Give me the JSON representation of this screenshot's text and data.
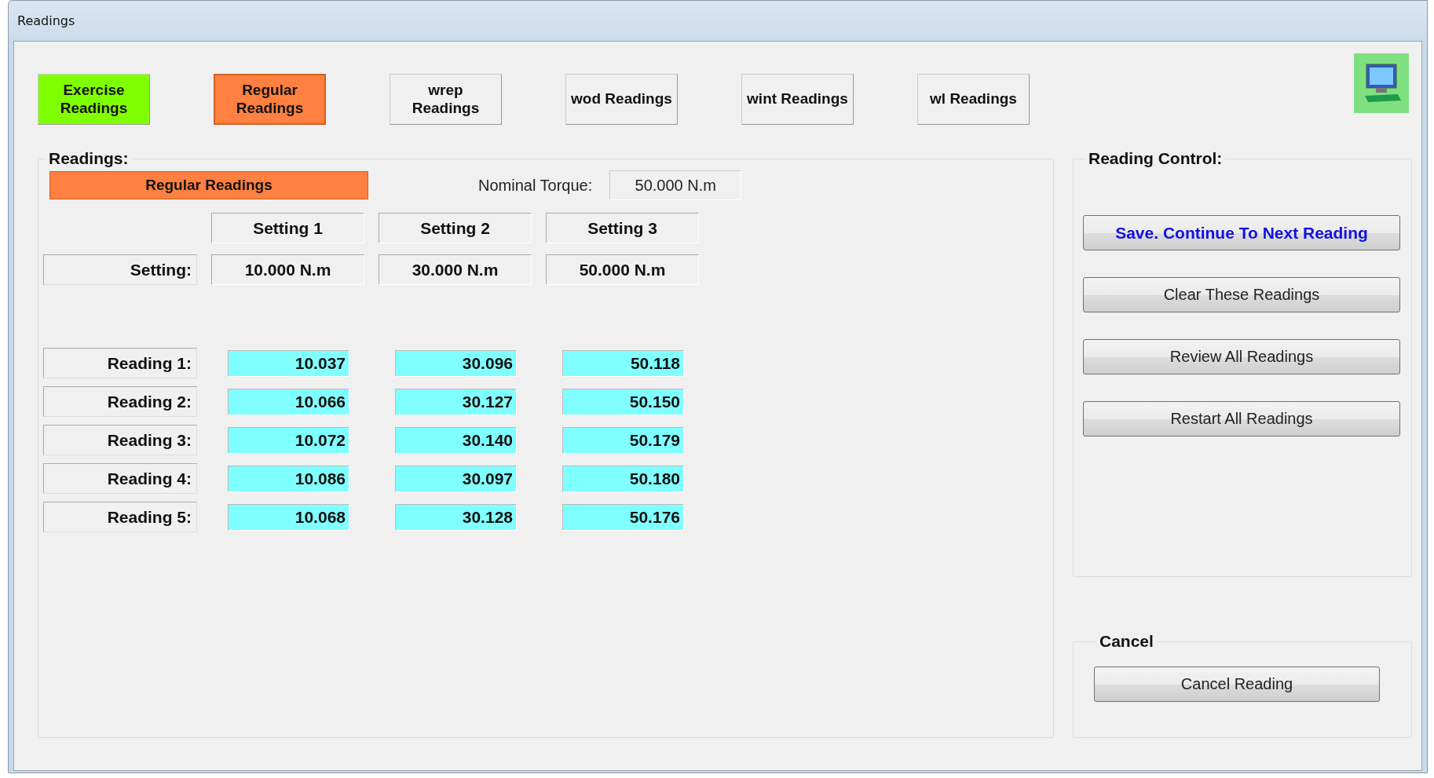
{
  "window": {
    "title": "Readings"
  },
  "tabs": [
    {
      "label": "Exercise Readings",
      "color": "#80ff00",
      "selected": false
    },
    {
      "label": "Regular Readings",
      "color": "#ff8040",
      "selected": true
    },
    {
      "label": "wrep Readings",
      "color": "#f0f0f0",
      "selected": false
    },
    {
      "label": "wod Readings",
      "color": "#f0f0f0",
      "selected": false
    },
    {
      "label": "wint Readings",
      "color": "#f0f0f0",
      "selected": false
    },
    {
      "label": "wl Readings",
      "color": "#f0f0f0",
      "selected": false
    }
  ],
  "readings": {
    "title": "Readings:",
    "banner": "Regular Readings",
    "nominal_torque_label": "Nominal Torque:",
    "nominal_torque": "50.000 N.m",
    "columns": [
      "Setting 1",
      "Setting 2",
      "Setting 3"
    ],
    "setting_label": "Setting:",
    "settings": [
      "10.000 N.m",
      "30.000 N.m",
      "50.000 N.m"
    ],
    "rows": [
      {
        "label": "Reading 1:",
        "values": [
          "10.037",
          "30.096",
          "50.118"
        ]
      },
      {
        "label": "Reading 2:",
        "values": [
          "10.066",
          "30.127",
          "50.150"
        ]
      },
      {
        "label": "Reading 3:",
        "values": [
          "10.072",
          "30.140",
          "50.179"
        ]
      },
      {
        "label": "Reading 4:",
        "values": [
          "10.086",
          "30.097",
          "50.180"
        ]
      },
      {
        "label": "Reading 5:",
        "values": [
          "10.068",
          "30.128",
          "50.176"
        ]
      }
    ]
  },
  "reading_control": {
    "title": "Reading Control:",
    "buttons": [
      {
        "label": "Save. Continue To Next Reading",
        "kind": "primary"
      },
      {
        "label": "Clear These Readings",
        "kind": "normal"
      },
      {
        "label": "Review All Readings",
        "kind": "normal"
      },
      {
        "label": "Restart All Readings",
        "kind": "normal"
      }
    ]
  },
  "cancel": {
    "title": "Cancel",
    "button": "Cancel Reading"
  }
}
